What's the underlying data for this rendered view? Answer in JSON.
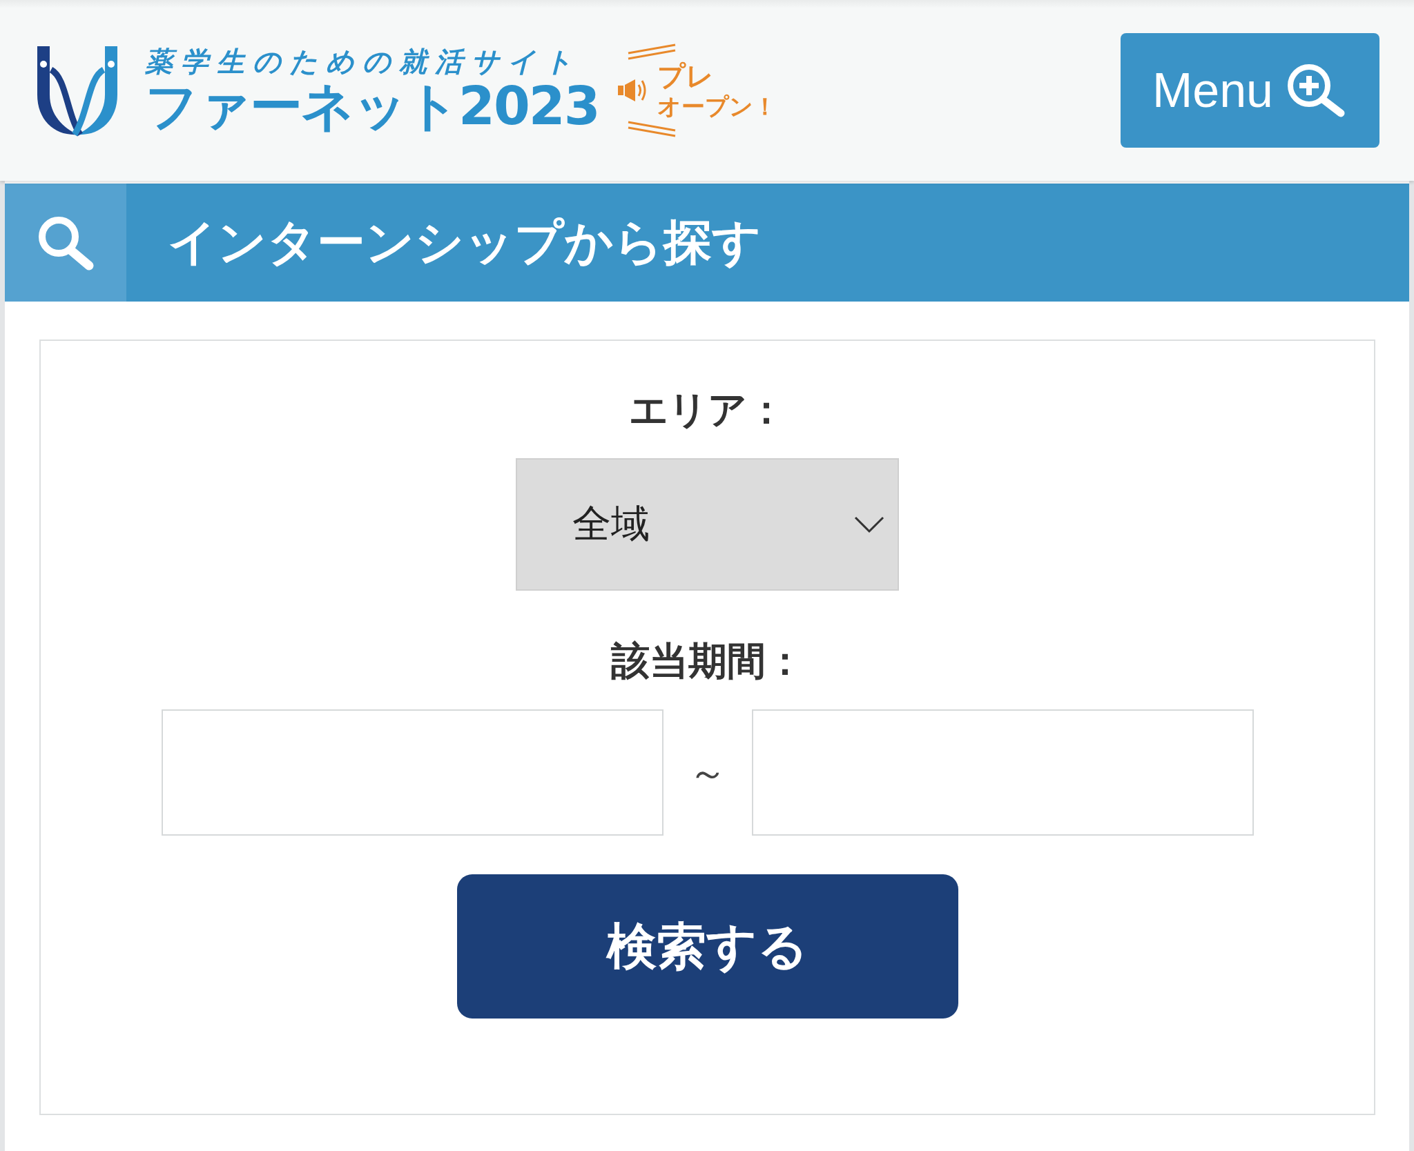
{
  "header": {
    "logo": {
      "tagline": "薬学生のための就活サイト",
      "name": "ファーネット2023",
      "badge": {
        "line_1": "プレ",
        "line_2": "オープン！"
      }
    },
    "menu_button": {
      "label": "Menu"
    }
  },
  "section": {
    "title": "インターンシップから探す"
  },
  "form": {
    "fields": [
      {
        "kind": "select",
        "label": "エリア：",
        "value": "全域"
      },
      {
        "kind": "date_range",
        "label": "該当期間：",
        "separator": "～"
      }
    ],
    "submit": "検索する"
  }
}
